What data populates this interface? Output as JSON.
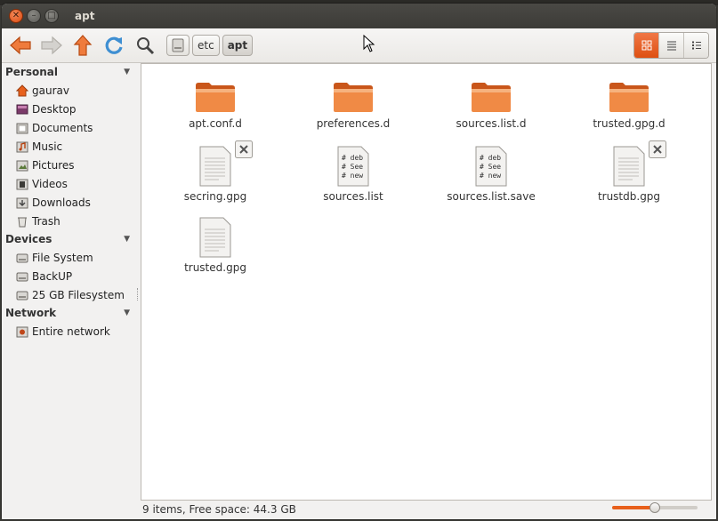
{
  "window": {
    "title": "apt"
  },
  "toolbar": {
    "back_icon": "arrow-left-icon",
    "forward_icon": "arrow-right-icon",
    "up_icon": "arrow-up-icon",
    "reload_icon": "reload-icon",
    "search_icon": "search-icon",
    "breadcrumbs": [
      {
        "label": "",
        "icon": "drive-icon"
      },
      {
        "label": "etc"
      },
      {
        "label": "apt",
        "active": true
      }
    ],
    "views": [
      "icon-view",
      "list-view",
      "compact-view"
    ],
    "active_view": "icon-view"
  },
  "sidebar": {
    "sections": [
      {
        "title": "Personal",
        "items": [
          {
            "label": "gaurav",
            "icon": "home-icon"
          },
          {
            "label": "Desktop",
            "icon": "desktop-icon"
          },
          {
            "label": "Documents",
            "icon": "documents-icon"
          },
          {
            "label": "Music",
            "icon": "music-icon"
          },
          {
            "label": "Pictures",
            "icon": "pictures-icon"
          },
          {
            "label": "Videos",
            "icon": "videos-icon"
          },
          {
            "label": "Downloads",
            "icon": "downloads-icon"
          },
          {
            "label": "Trash",
            "icon": "trash-icon"
          }
        ]
      },
      {
        "title": "Devices",
        "items": [
          {
            "label": "File System",
            "icon": "drive-icon"
          },
          {
            "label": "BackUP",
            "icon": "drive-icon"
          },
          {
            "label": "25 GB Filesystem",
            "icon": "drive-icon"
          }
        ]
      },
      {
        "title": "Network",
        "items": [
          {
            "label": "Entire network",
            "icon": "network-icon"
          }
        ]
      }
    ]
  },
  "files": [
    {
      "name": "apt.conf.d",
      "type": "folder"
    },
    {
      "name": "preferences.d",
      "type": "folder"
    },
    {
      "name": "sources.list.d",
      "type": "folder"
    },
    {
      "name": "trusted.gpg.d",
      "type": "folder"
    },
    {
      "name": "secring.gpg",
      "type": "document",
      "emblem": "unreadable"
    },
    {
      "name": "sources.list",
      "type": "text",
      "preview": [
        "# deb",
        "# See",
        "# new"
      ]
    },
    {
      "name": "sources.list.save",
      "type": "text",
      "preview": [
        "# deb",
        "# See",
        "# new"
      ]
    },
    {
      "name": "trustdb.gpg",
      "type": "document",
      "emblem": "unreadable"
    },
    {
      "name": "trusted.gpg",
      "type": "document"
    }
  ],
  "status": {
    "text": "9 items, Free space: 44.3 GB",
    "zoom_level": 0.5
  },
  "colors": {
    "accent": "#e8601c",
    "folder": "#f07e3a"
  }
}
